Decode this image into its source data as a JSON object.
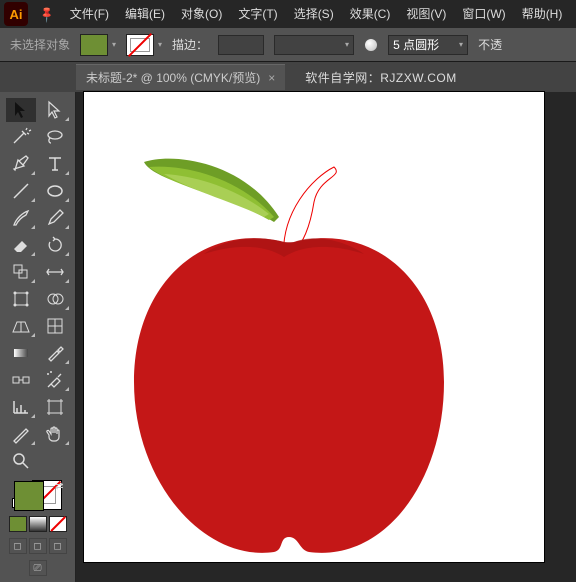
{
  "app": {
    "logo": "Ai"
  },
  "menu": [
    "文件(F)",
    "编辑(E)",
    "对象(O)",
    "文字(T)",
    "选择(S)",
    "效果(C)",
    "视图(V)",
    "窗口(W)",
    "帮助(H)"
  ],
  "optbar": {
    "no_selection": "未选择对象",
    "stroke_label": "描边：",
    "stroke_val": "",
    "point_val": "5 点圆形",
    "opacity_label": "不透"
  },
  "tab": {
    "title": "未标题-2* @ 100% (CMYK/预览)",
    "close": "×"
  },
  "watermark": "软件自学网：RJZXW.COM",
  "colors": {
    "fill": "#6e8f34",
    "apple": "#c41717",
    "apple_dark": "#a31212",
    "leaf1": "#6e9e26",
    "leaf2": "#8fbf33",
    "leaf3": "#a9cf55"
  }
}
